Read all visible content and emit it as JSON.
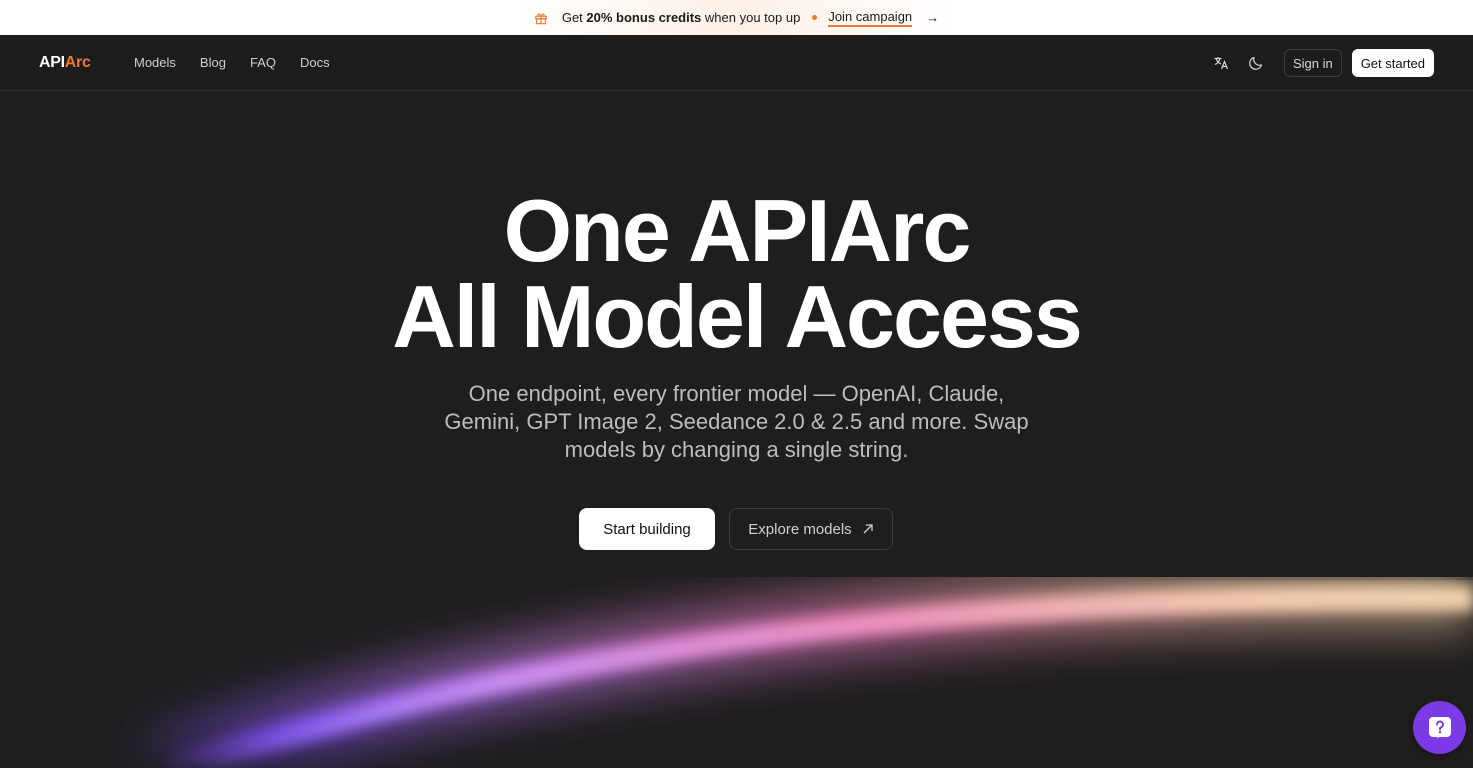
{
  "promo": {
    "prefix": "Get ",
    "bold": "20% bonus credits",
    "suffix": " when you top up",
    "link": "Join campaign",
    "icon": "gift-icon",
    "arrow_icon": "arrow-right-icon",
    "accent": "#f0782a"
  },
  "nav": {
    "logo_a": "API",
    "logo_b": "Arc",
    "links": [
      "Models",
      "Blog",
      "FAQ",
      "Docs"
    ],
    "translate_icon": "translate-icon",
    "theme_icon": "moon-icon",
    "sign_in": "Sign in",
    "get_started": "Get started"
  },
  "hero": {
    "title_line1": "One APIArc",
    "title_line2": "All Model Access",
    "subtitle": "One endpoint, every frontier model — OpenAI, Claude, Gemini, GPT Image 2, Seedance 2.0 & 2.5 and more. Swap models by changing a single string.",
    "primary_cta": "Start building",
    "secondary_cta": "Explore models",
    "secondary_icon": "arrow-up-right-icon"
  },
  "help": {
    "icon": "help-question-icon",
    "color": "#7c3ae6"
  }
}
